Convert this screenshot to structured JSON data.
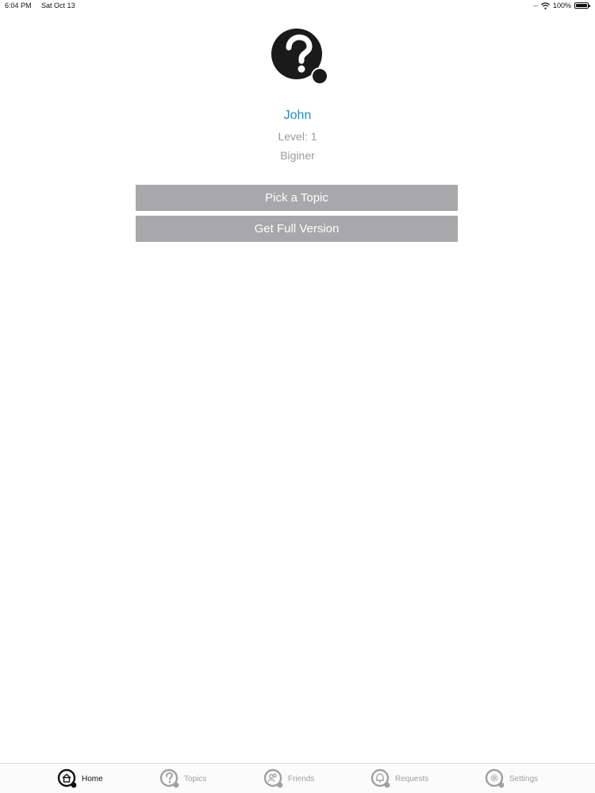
{
  "status_bar": {
    "time": "6:04 PM",
    "date": "Sat Oct 13",
    "battery_text": "100%",
    "icons": [
      "wifi-icon",
      "battery-icon"
    ]
  },
  "profile": {
    "name": "John",
    "level": "Level: 1",
    "rank": "Biginer"
  },
  "buttons": {
    "pick_topic": "Pick a Topic",
    "full_version": "Get Full Version"
  },
  "tab_bar": {
    "active": "Home",
    "tabs": [
      {
        "label": "Home",
        "icon": "home-icon"
      },
      {
        "label": "Topics",
        "icon": "question-icon"
      },
      {
        "label": "Friends",
        "icon": "friends-icon"
      },
      {
        "label": "Requests",
        "icon": "bell-icon"
      },
      {
        "label": "Settings",
        "icon": "gear-icon"
      }
    ]
  },
  "colors": {
    "accent": "#1e8ed0",
    "button_bg": "#a8a8aa",
    "muted_text": "#9a9a9a",
    "logo": "#1a1a1a"
  }
}
